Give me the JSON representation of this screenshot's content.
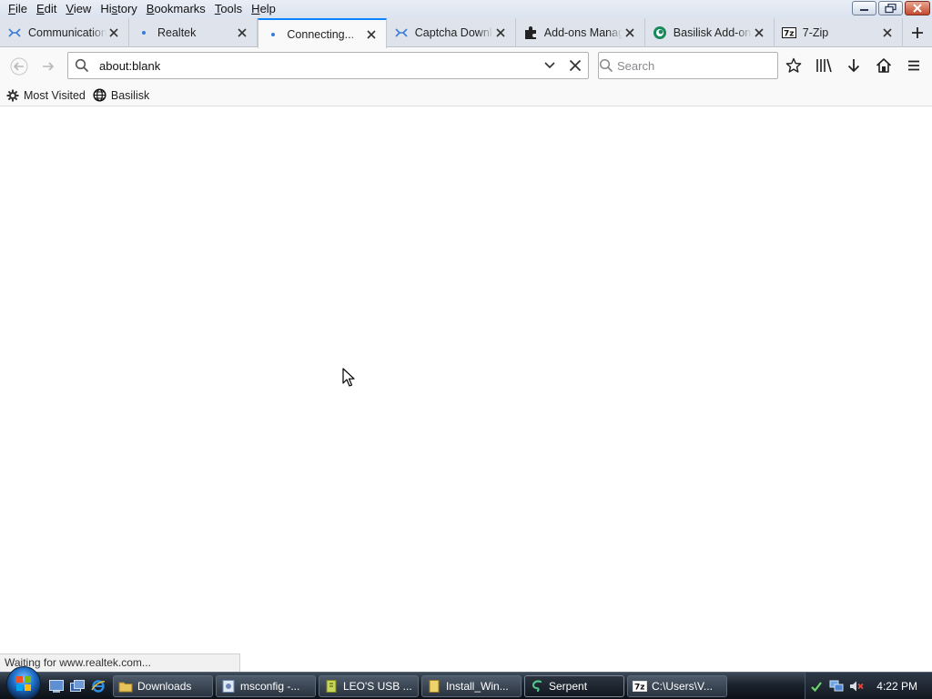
{
  "menu": [
    "File",
    "Edit",
    "View",
    "History",
    "Bookmarks",
    "Tools",
    "Help"
  ],
  "menu_access_keys": [
    "F",
    "E",
    "V",
    "s",
    "B",
    "T",
    "H"
  ],
  "tabs": [
    {
      "title": "Communication",
      "icon": "wifi-icon",
      "active": false
    },
    {
      "title": "Realtek",
      "icon": "dot-icon",
      "active": false
    },
    {
      "title": "Connecting...",
      "icon": "dot-icon",
      "active": true
    },
    {
      "title": "Captcha Download",
      "icon": "wifi-icon",
      "active": false
    },
    {
      "title": "Add-ons Manager",
      "icon": "puzzle-icon",
      "active": false
    },
    {
      "title": "Basilisk Add-ons",
      "icon": "basilisk-icon",
      "active": false
    },
    {
      "title": "7-Zip",
      "icon": "7zip-icon",
      "active": false
    }
  ],
  "navbar": {
    "url": "about:blank",
    "search_placeholder": "Search"
  },
  "bookmarks": [
    {
      "label": "Most Visited",
      "icon": "gear-icon"
    },
    {
      "label": "Basilisk",
      "icon": "globe-icon"
    }
  ],
  "status_text": "Waiting for www.realtek.com...",
  "taskbar": {
    "tasks": [
      {
        "label": "Downloads",
        "icon": "folder-icon",
        "active": false
      },
      {
        "label": "msconfig -...",
        "icon": "msconfig-icon",
        "active": false
      },
      {
        "label": "LEO'S USB ...",
        "icon": "usb-icon",
        "active": false
      },
      {
        "label": "Install_Win...",
        "icon": "folder-icon",
        "active": false
      },
      {
        "label": "Serpent",
        "icon": "serpent-icon",
        "active": true
      },
      {
        "label": "C:\\Users\\V...",
        "icon": "7zip-icon",
        "active": false
      }
    ],
    "clock": "4:22 PM"
  },
  "colors": {
    "accent": "#0a84ff",
    "toolbar_bg": "#f9f9fa",
    "tabstrip_bg": "#dfe4ec",
    "taskbar_bg": "#1b232d"
  }
}
